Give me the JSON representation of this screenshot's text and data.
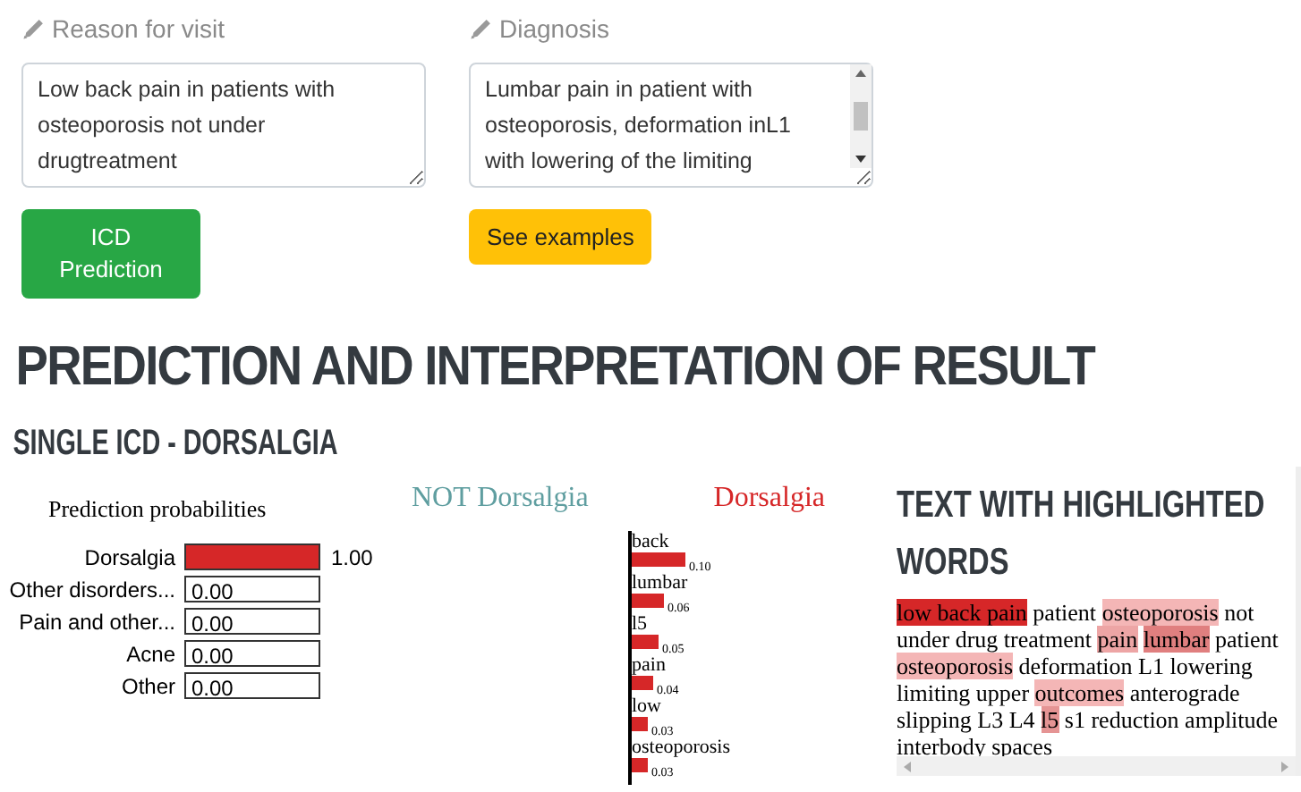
{
  "fields": [
    {
      "label": "Reason for visit",
      "value": "Low back pain in patients with osteoporosis not under drugtreatment",
      "scrollable": false
    },
    {
      "label": "Diagnosis",
      "value": "Lumbar pain in patient with osteoporosis, deformation inL1 with lowering of the limiting",
      "scrollable": true
    }
  ],
  "buttons": [
    {
      "label": "ICD Prediction",
      "kind": "primary"
    },
    {
      "label": "See examples",
      "kind": "warning"
    }
  ],
  "heading": "PREDICTION AND INTERPRETATION OF RESULT",
  "subheading": "SINGLE ICD - DORSALGIA",
  "probabilities": {
    "title": "Prediction probabilities",
    "items": [
      {
        "name": "Dorsalgia",
        "level": 1.0,
        "reading": "1.00"
      },
      {
        "name": "Other disorders...",
        "level": 0,
        "reading": "0.00"
      },
      {
        "name": "Pain and other...",
        "level": 0,
        "reading": "0.00"
      },
      {
        "name": "Acne",
        "level": 0,
        "reading": "0.00"
      },
      {
        "name": "Other",
        "level": 0,
        "reading": "0.00"
      }
    ]
  },
  "explanation": {
    "negative_label": "NOT Dorsalgia",
    "positive_label": "Dorsalgia",
    "chart_data": {
      "type": "bar",
      "orientation": "horizontal",
      "categories": [
        "back",
        "lumbar",
        "l5",
        "pain",
        "low",
        "osteoporosis"
      ],
      "values": [
        0.1,
        0.06,
        0.05,
        0.04,
        0.03,
        0.03
      ],
      "value_labels": [
        "0.10",
        "0.06",
        "0.05",
        "0.04",
        "0.03",
        "0.03"
      ]
    }
  },
  "highlighted": {
    "title": "TEXT WITH HIGHLIGHTED WORDS",
    "segments": [
      {
        "text": "low back pain",
        "color": "#d62728"
      },
      {
        "text": "patient"
      },
      {
        "text": "osteoporosis",
        "color": "#f4b6b6"
      },
      {
        "text": "not under drug treatment"
      },
      {
        "text": "pain",
        "color": "#eda5a5"
      },
      {
        "text": "lumbar",
        "color": "#e07f7f"
      },
      {
        "text": "patient"
      },
      {
        "text": "osteoporosis",
        "color": "#f4b6b6"
      },
      {
        "text": "deformation L1 lowering limiting upper"
      },
      {
        "text": "outcomes",
        "color": "#f4b6b6"
      },
      {
        "text": "anterograde slipping L3 L4"
      },
      {
        "text": "l5",
        "color": "#e59494"
      },
      {
        "text": "s1 reduction amplitude interbody spaces"
      }
    ]
  }
}
